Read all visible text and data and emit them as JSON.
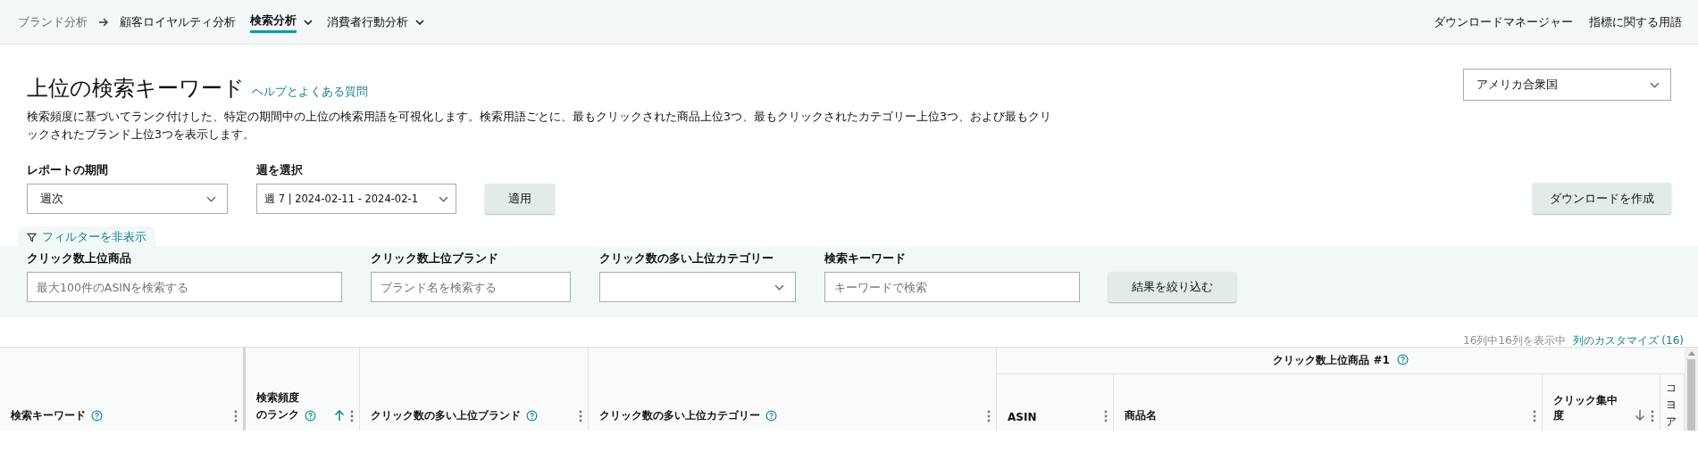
{
  "nav": {
    "items": [
      {
        "label": "ブランド分析",
        "kind": "crumb",
        "selected": false
      },
      {
        "label": "顧客ロイヤルティ分析",
        "kind": "link",
        "selected": false
      },
      {
        "label": "検索分析",
        "kind": "menu",
        "selected": true
      },
      {
        "label": "消費者行動分析",
        "kind": "menu",
        "selected": false
      }
    ],
    "right": [
      "ダウンロードマネージャー",
      "指標に関する用語"
    ]
  },
  "page": {
    "title": "上位の検索キーワード",
    "help_link": "ヘルプとよくある質問",
    "description": "検索頻度に基づいてランク付けした、特定の期間中の上位の検索用語を可視化します。検索用語ごとに、最もクリックされた商品上位3つ、最もクリックされたカテゴリー上位3つ、および最もクリックされたブランド上位3つを表示します。",
    "country": "アメリカ合衆国"
  },
  "controls": {
    "period": {
      "label": "レポートの期間",
      "value": "週次"
    },
    "week": {
      "label": "週を選択",
      "value": "週 7 | 2024-02-11 - 2024-02-1"
    },
    "apply_button": "適用",
    "download_button": "ダウンロードを作成"
  },
  "filter_toggle": "フィルターを非表示",
  "filters": [
    {
      "kind": "input",
      "label": "クリック数上位商品",
      "placeholder": "最大100件のASINを検索する"
    },
    {
      "kind": "input",
      "label": "クリック数上位ブランド",
      "placeholder": "ブランド名を検索する"
    },
    {
      "kind": "select",
      "label": "クリック数の多い上位カテゴリー"
    },
    {
      "kind": "input",
      "label": "検索キーワード",
      "placeholder": "キーワードで検索"
    }
  ],
  "filter_button": "結果を絞り込む",
  "column_info": {
    "count": "16列中16列を表示中",
    "customize_link": "列のカスタマイズ (16)"
  },
  "table": {
    "columns": [
      {
        "label": "検索キーワード",
        "help": true,
        "menu": true,
        "sorted_up": false,
        "sorted_down": false
      },
      {
        "label": "検索頻度のランク",
        "help": true,
        "menu": true,
        "sorted_up": true,
        "sorted_down": false
      },
      {
        "label": "クリック数の多い上位ブランド",
        "help": true,
        "menu": true,
        "sorted_up": false,
        "sorted_down": false
      },
      {
        "label": "クリック数の多い上位カテゴリー",
        "help": true,
        "menu": true,
        "sorted_up": false,
        "sorted_down": false
      }
    ],
    "group": {
      "header": "クリック数上位商品 #1",
      "columns": [
        {
          "label": "ASIN",
          "help": false,
          "menu": true,
          "sorted_up": false,
          "sorted_down": false
        },
        {
          "label": "商品名",
          "help": false,
          "menu": true,
          "sorted_up": false,
          "sorted_down": false
        },
        {
          "label": "クリック集中度",
          "help": false,
          "menu": true,
          "sorted_up": false,
          "sorted_down": true
        },
        {
          "label": "コヨア",
          "help": false,
          "menu": false,
          "sorted_up": false,
          "sorted_down": false
        }
      ]
    }
  }
}
